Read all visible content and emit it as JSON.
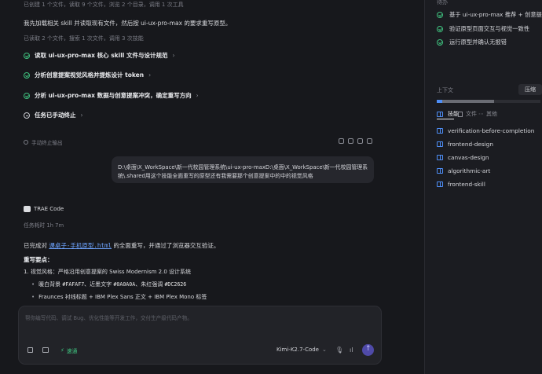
{
  "chat": {
    "summary_top": "已创建 1 个文件，读取 9 个文件，浏览 2 个目录，调用 1 次工具",
    "intro": "我先加载相关 skill 并读取现有文件，然后按 ui-ux-pro-max 的要求重写原型。",
    "summary2": "已读取 2 个文件，搜索 1 次文件，调用 3 次技能",
    "steps": [
      {
        "label": "读取 ui-ux-pro-max 核心 skill 文件与设计规范",
        "status": "done"
      },
      {
        "label": "分析创意提案视觉风格并提炼设计 token",
        "status": "done"
      },
      {
        "label": "分析 ui-ux-pro-max 数据与创意提案冲突，确定重写方向",
        "status": "done"
      },
      {
        "label": "任务已手动终止",
        "status": "stopped"
      }
    ],
    "stopped_output": "手动终止输出",
    "user_message": {
      "line1": "D:\\桌面\\X_WorkSpace\\新一代校园管理系统\\ui-ux-pro-maxD:\\桌面\\X_WorkSpace\\新一代校园管理系",
      "line2": "统\\.shared用这个技能全面重写的原型还有我需要那个创意提案中的中的视觉风格"
    },
    "agent_name": "TRAE Code",
    "duration": "任务耗时 1h 7m",
    "result_prefix": "已完成对 ",
    "result_link": "课桌子-手机原型.html",
    "result_suffix": " 的全面重写，并通过了浏览器交互验证。",
    "changes_title": "重写要点：",
    "item1": "1. 视觉风格：严格沿用创意提案的 Swiss Modernism 2.0 设计系统",
    "sub1_prefix": "暖白背景 ",
    "sub1_code1": "#FAFAF7",
    "sub1_mid": "、近墨文字 ",
    "sub1_code2": "#0A0A0A",
    "sub1_mid2": "、朱红强调 ",
    "sub1_code3": "#DC2626",
    "sub2": "Fraunces 衬线标题 + IBM Plex Sans 正文 + IBM Plex Mono 标签"
  },
  "input": {
    "placeholder": "帮你编写代码、调试 Bug、优化性能等开发工作，交付生产级代码产物。",
    "mode": "速通",
    "model": "Kimi-K2.7-Code"
  },
  "side": {
    "header": "待办",
    "todos": [
      "基于 ui-ux-pro-max 推荐 + 创意提案",
      "验证原型页面交互与视觉一致性",
      "运行原型并确认无报错"
    ],
    "context_label": "上下文",
    "compress_label": "压缩",
    "context_fraction": 0.55,
    "tabs": [
      "技能",
      "文件",
      "其他"
    ],
    "skills": [
      "verification-before-completion",
      "frontend-design",
      "canvas-design",
      "algorithmic-art",
      "frontend-skill"
    ]
  },
  "colors": {
    "accent": "#4e8ef7",
    "success": "#3fc27f",
    "link": "#6ea4ff"
  }
}
